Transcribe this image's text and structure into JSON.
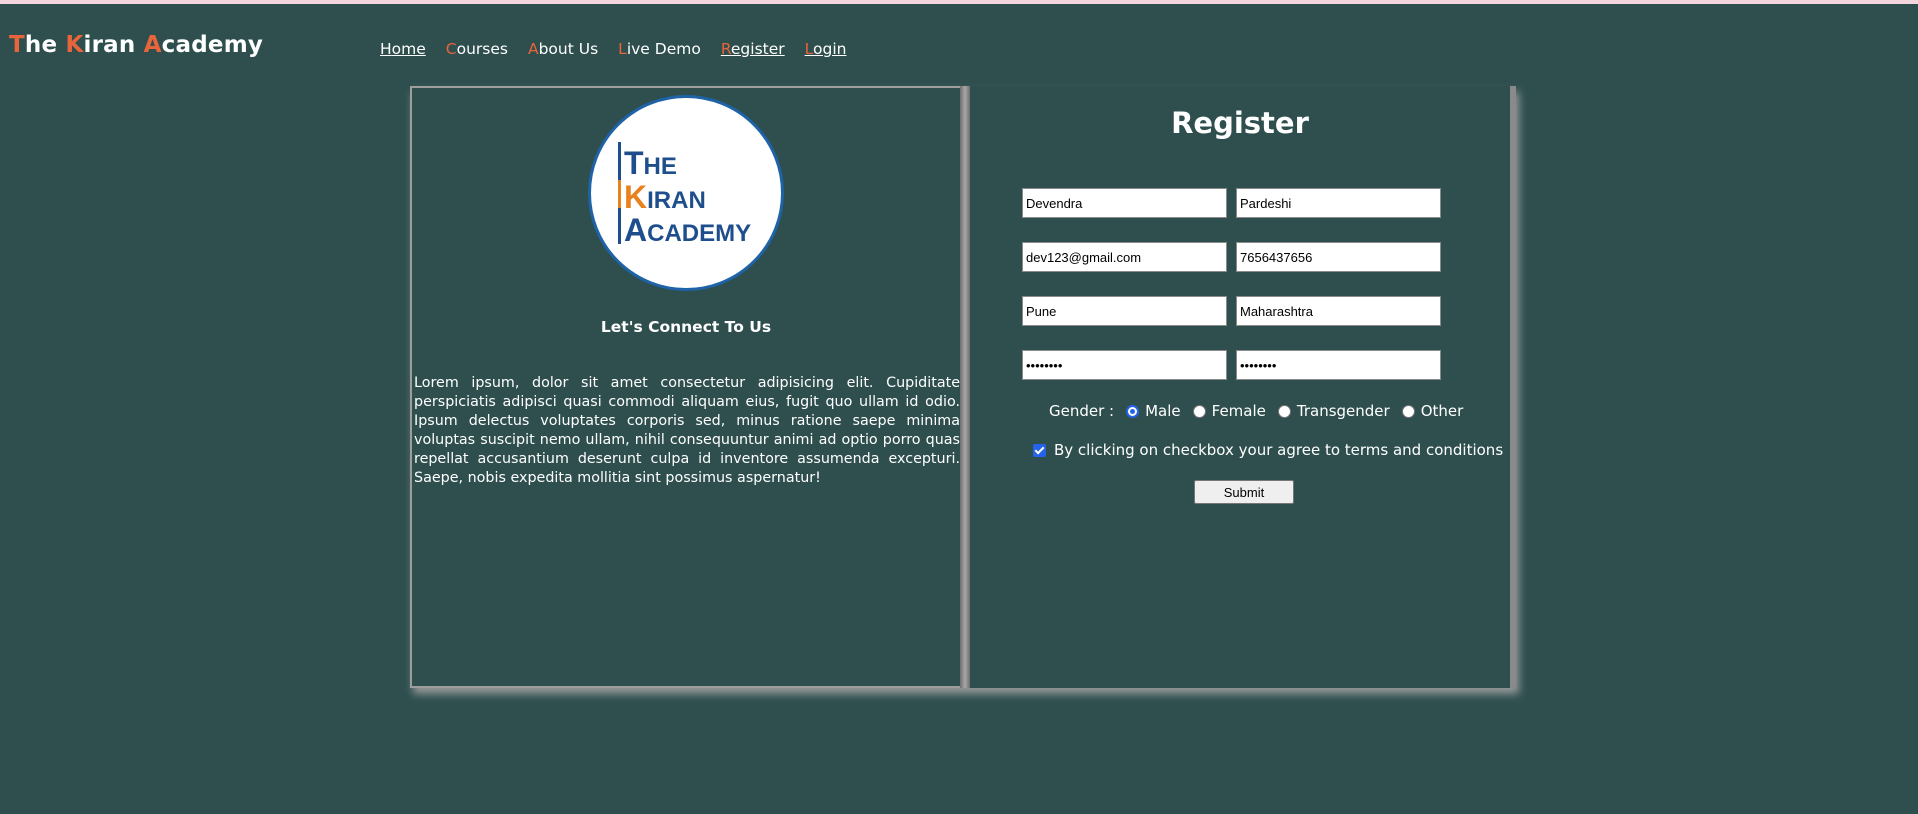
{
  "brand": {
    "p1": "T",
    "p2": "he ",
    "p3": "K",
    "p4": "iran ",
    "p5": "A",
    "p6": "cademy"
  },
  "nav": [
    {
      "first": "H",
      "rest": "ome"
    },
    {
      "first": "C",
      "rest": "ourses"
    },
    {
      "first": "A",
      "rest": "bout Us"
    },
    {
      "first": "L",
      "rest": "ive Demo"
    },
    {
      "first": "R",
      "rest": "egister"
    },
    {
      "first": "L",
      "rest": "ogin"
    }
  ],
  "left": {
    "logo": {
      "line1_initial": "T",
      "line1_rest": "HE",
      "line2_initial": "K",
      "line2_rest": "IRAN",
      "line3_initial": "A",
      "line3_rest": "CADEMY"
    },
    "heading": "Let's Connect To Us",
    "paragraph": "Lorem ipsum, dolor sit amet consectetur adipisicing elit. Cupiditate perspiciatis adipisci quasi commodi aliquam eius, fugit quo ullam id odio. Ipsum delectus voluptates corporis sed, minus ratione saepe minima voluptas suscipit nemo ullam, nihil consequuntur animi ad optio porro quas repellat accusantium deserunt culpa id inventore assumenda excepturi. Saepe, nobis expedita mollitia sint possimus aspernatur!"
  },
  "form": {
    "title": "Register",
    "first_name": "Devendra",
    "last_name": "Pardeshi",
    "email": "dev123@gmail.com",
    "phone": "7656437656",
    "city": "Pune",
    "state": "Maharashtra",
    "password": "••••••••",
    "confirm_password": "••••••••",
    "gender_label": "Gender :",
    "gender_options": [
      "Male",
      "Female",
      "Transgender",
      "Other"
    ],
    "gender_selected": "Male",
    "terms_label": "By clicking on checkbox your agree to terms and conditions",
    "terms_checked": true,
    "submit_label": "Submit"
  },
  "colors": {
    "background": "#2f4f4f",
    "accent": "#e8643a",
    "logo_blue": "#1e4f8c",
    "logo_orange": "#e8821f"
  }
}
